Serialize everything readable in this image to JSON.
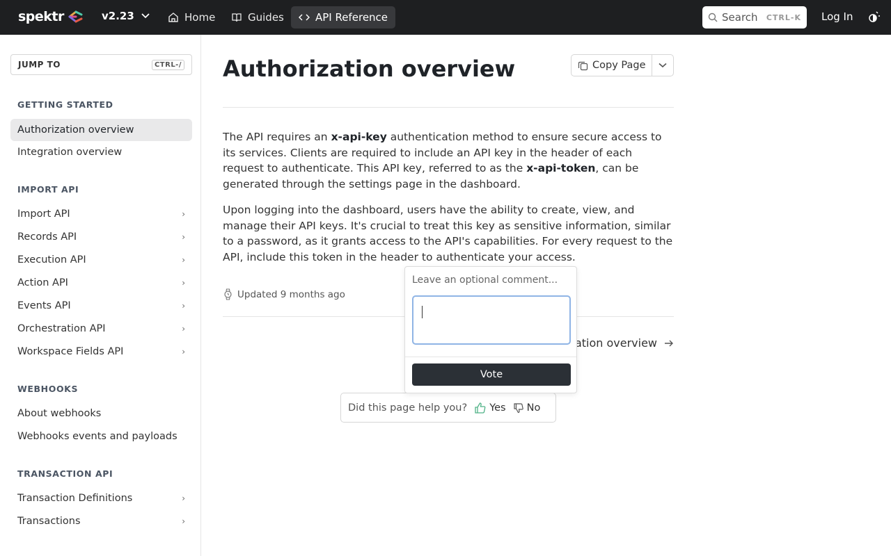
{
  "header": {
    "logo_text": "spektr",
    "version": "v2.23",
    "tabs": [
      {
        "label": "Home"
      },
      {
        "label": "Guides"
      },
      {
        "label": "API Reference"
      }
    ],
    "search_label": "Search",
    "search_shortcut": "CTRL-K",
    "login_label": "Log In"
  },
  "sidebar": {
    "jump_label": "JUMP TO",
    "jump_shortcut": "CTRL-/",
    "sections": [
      {
        "title": "GETTING STARTED",
        "items": [
          {
            "label": "Authorization overview"
          },
          {
            "label": "Integration overview"
          }
        ]
      },
      {
        "title": "IMPORT API",
        "items": [
          {
            "label": "Import API"
          },
          {
            "label": "Records API"
          },
          {
            "label": "Execution API"
          },
          {
            "label": "Action API"
          },
          {
            "label": "Events API"
          },
          {
            "label": "Orchestration API"
          },
          {
            "label": "Workspace Fields API"
          }
        ]
      },
      {
        "title": "WEBHOOKS",
        "items": [
          {
            "label": "About webhooks"
          },
          {
            "label": "Webhooks events and payloads"
          }
        ]
      },
      {
        "title": "TRANSACTION API",
        "items": [
          {
            "label": "Transaction Definitions"
          },
          {
            "label": "Transactions"
          }
        ]
      }
    ]
  },
  "main": {
    "title": "Authorization overview",
    "copy_label": "Copy Page",
    "p1_a": "The API requires an ",
    "p1_b": "x-api-key",
    "p1_c": " authentication method to ensure secure access to its services. Clients are required to include an API key in the header of each request to authenticate. This API key, referred to as the ",
    "p1_d": "x-api-token",
    "p1_e": ", can be generated through the settings page in the dashboard.",
    "p2": "Upon logging into the dashboard, users have the ability to create, view, and manage their API keys. It's crucial to treat this key as sensitive information, similar to a password, as it grants access to the API's capabilities. For every request to the API, include this token in the header to authenticate your access.",
    "updated": "Updated 9 months ago",
    "next_label": "ation overview"
  },
  "feedback": {
    "question": "Did this page help you?",
    "yes": "Yes",
    "no": "No"
  },
  "popover": {
    "label": "Leave an optional comment...",
    "vote": "Vote"
  }
}
